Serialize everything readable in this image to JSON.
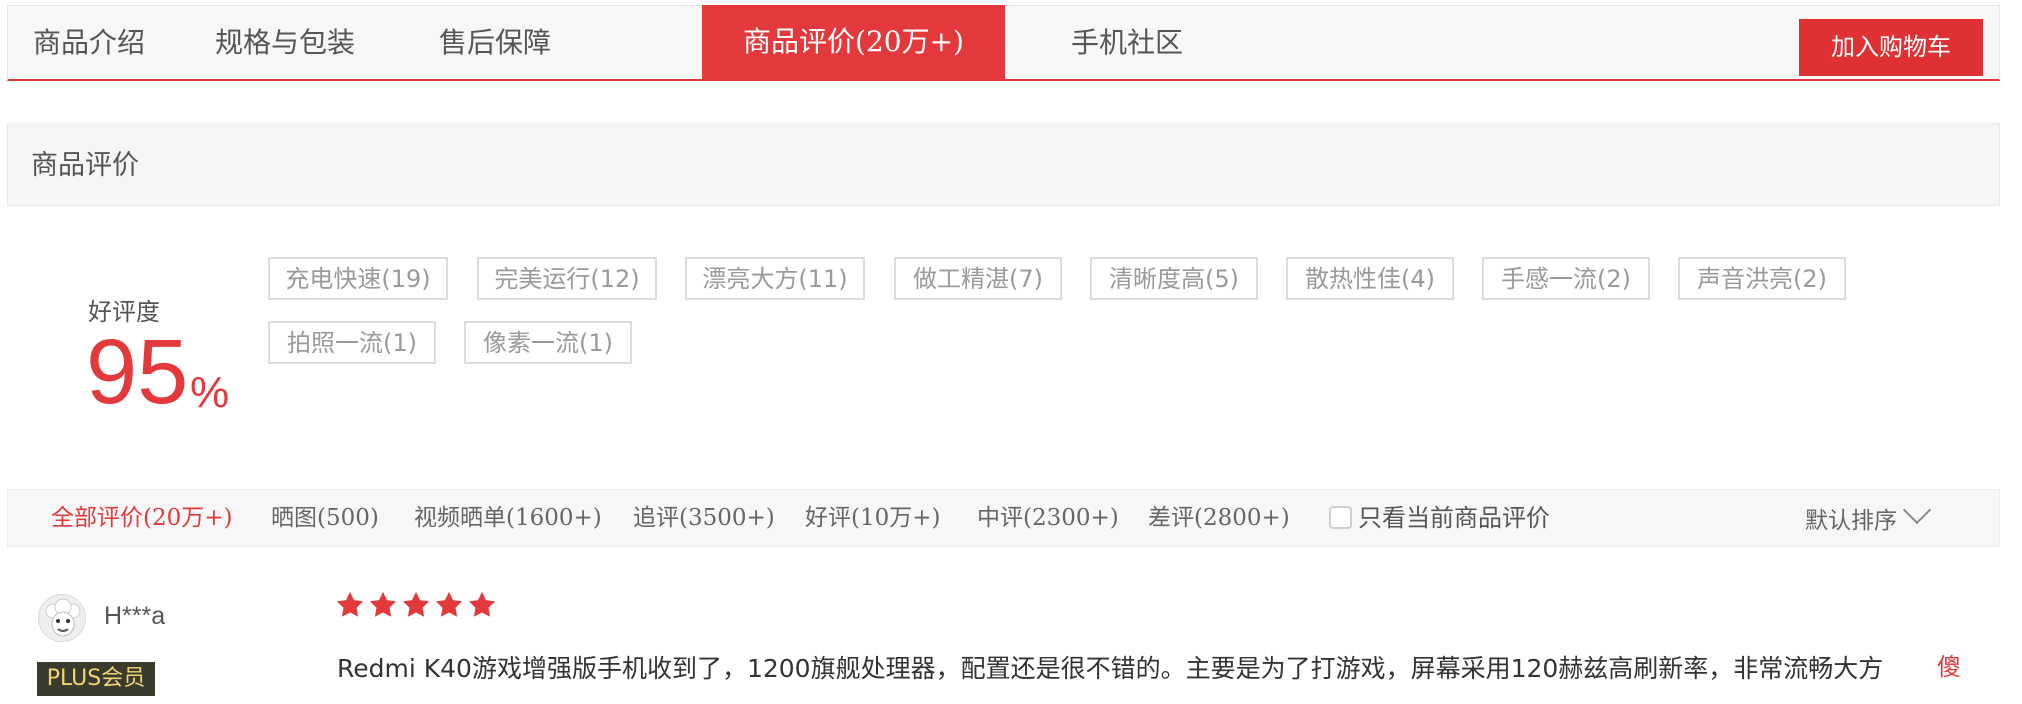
{
  "tabs": [
    {
      "label": "商品介绍"
    },
    {
      "label": "规格与包装"
    },
    {
      "label": "售后保障"
    },
    {
      "label": "商品评价(20万+)"
    },
    {
      "label": "手机社区"
    }
  ],
  "cart_button": "加入购物车",
  "section_title": "商品评价",
  "rating": {
    "label": "好评度",
    "value": "95",
    "unit": "%"
  },
  "tags": [
    "充电快速(19)",
    "完美运行(12)",
    "漂亮大方(11)",
    "做工精湛(7)",
    "清晰度高(5)",
    "散热性佳(4)",
    "手感一流(2)",
    "声音洪亮(2)",
    "拍照一流(1)",
    "像素一流(1)"
  ],
  "filters": [
    "全部评价(20万+)",
    "晒图(500)",
    "视频晒单(1600+)",
    "追评(3500+)",
    "好评(10万+)",
    "中评(2300+)",
    "差评(2800+)"
  ],
  "only_current_label": "只看当前商品评价",
  "sort_label": "默认排序",
  "review": {
    "user": "H***a",
    "badge": "PLUS会员",
    "stars": 5,
    "text": "Redmi K40游戏增强版手机收到了，1200旗舰处理器，配置还是很不错的。主要是为了打游戏，屏幕采用120赫兹高刷新率，非常流畅大方",
    "float_char": "傻"
  },
  "colors": {
    "accent": "#e4393c",
    "star": "#e4393c"
  }
}
